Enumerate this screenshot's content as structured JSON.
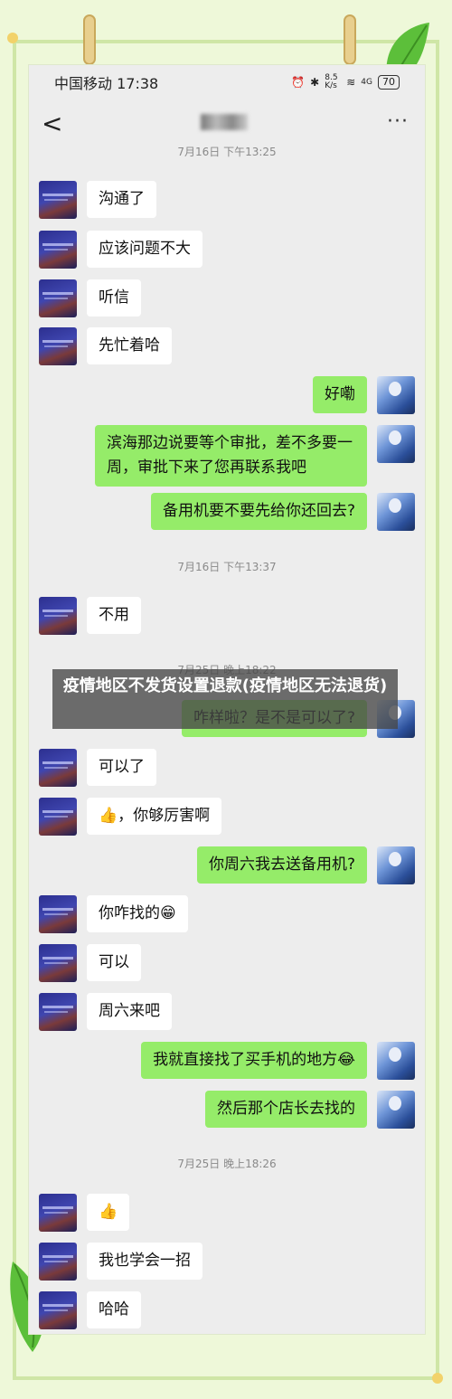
{
  "status_bar": {
    "carrier_time": "中国移动 17:38",
    "net_speed": "8.5 K/s",
    "signal": "4G",
    "battery": "70"
  },
  "nav": {
    "back": "<",
    "more": "···"
  },
  "timestamps": [
    "7月16日 下午13:25",
    "7月16日 下午13:37",
    "7月25日 晚上18:22",
    "7月25日 晚上18:26"
  ],
  "messages": [
    {
      "side": "left",
      "text": "沟通了"
    },
    {
      "side": "left",
      "text": "应该问题不大"
    },
    {
      "side": "left",
      "text": "听信"
    },
    {
      "side": "left",
      "text": "先忙着哈"
    },
    {
      "side": "right",
      "text": "好嘞"
    },
    {
      "side": "right",
      "text": "滨海那边说要等个审批，差不多要一周，审批下来了您再联系我吧"
    },
    {
      "side": "right",
      "text": "备用机要不要先给你还回去?"
    },
    {
      "side": "left",
      "text": "不用"
    },
    {
      "side": "right",
      "text": "咋样啦？是不是可以了?"
    },
    {
      "side": "left",
      "text": "可以了"
    },
    {
      "side": "left",
      "text": "👍，你够厉害啊"
    },
    {
      "side": "right",
      "text": "你周六我去送备用机?"
    },
    {
      "side": "left",
      "text": "你咋找的😁"
    },
    {
      "side": "left",
      "text": "可以"
    },
    {
      "side": "left",
      "text": "周六来吧"
    },
    {
      "side": "right",
      "text": "我就直接找了买手机的地方😂"
    },
    {
      "side": "right",
      "text": "然后那个店长去找的"
    },
    {
      "side": "left",
      "text": "👍"
    },
    {
      "side": "left",
      "text": "我也学会一招"
    },
    {
      "side": "left",
      "text": "哈哈"
    }
  ],
  "banner": {
    "title": "疫情地区不发货设置退款(疫情地区无法退货)"
  },
  "colors": {
    "sent_bubble": "#95ec69",
    "received_bubble": "#ffffff",
    "chat_bg": "#ededed",
    "page_bg": "#eef8d9"
  },
  "icons": [
    "back-arrow-icon",
    "more-icon",
    "alarm-icon",
    "bluetooth-icon",
    "wifi-icon",
    "battery-icon"
  ]
}
